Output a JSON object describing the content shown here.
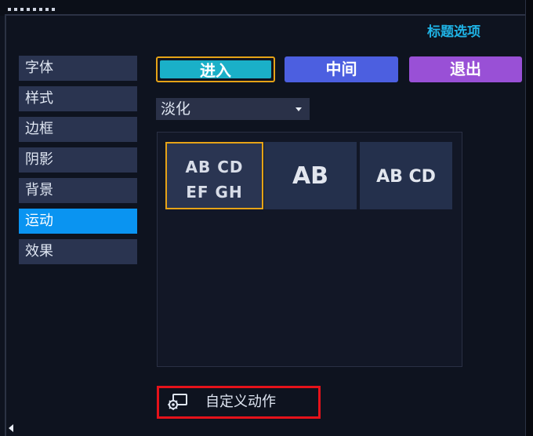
{
  "panel": {
    "title": "标题选项"
  },
  "sidebar": {
    "items": [
      {
        "label": "字体"
      },
      {
        "label": "样式"
      },
      {
        "label": "边框"
      },
      {
        "label": "阴影"
      },
      {
        "label": "背景"
      },
      {
        "label": "运动",
        "active": true
      },
      {
        "label": "效果"
      }
    ]
  },
  "motion_direction": {
    "enter": "进入",
    "middle": "中间",
    "exit": "退出",
    "selected": "进入"
  },
  "animation_type": {
    "selected": "淡化"
  },
  "presets": [
    {
      "line1": "AB CD",
      "line2": "EF GH",
      "selected": true
    },
    {
      "line1": "AB"
    },
    {
      "line1": "AB CD"
    }
  ],
  "custom_action": {
    "label": "自定义动作",
    "icon": "custom-action-icon"
  },
  "colors": {
    "accent": "#1fb3e5",
    "active_sidebar": "#0a94f1",
    "enter": "#1ab0c8",
    "middle": "#4c5fe0",
    "exit": "#9950d6",
    "highlight": "#e5121a",
    "selected_border": "#e6a317"
  }
}
